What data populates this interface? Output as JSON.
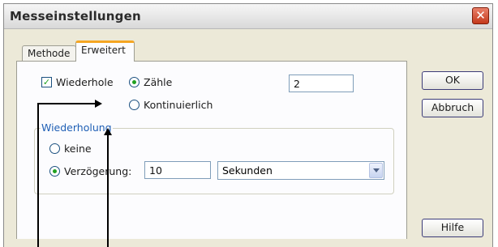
{
  "window": {
    "title": "Messeinstellungen"
  },
  "tabs": [
    {
      "label": "Methode"
    },
    {
      "label": "Erweitert"
    }
  ],
  "repeat": {
    "label": "Wiederhole",
    "checked": true
  },
  "mode": {
    "count_label": "Zähle",
    "continuous_label": "Kontinuierlich",
    "count_value": "2"
  },
  "group": {
    "title": "Wiederholung",
    "none_label": "keine",
    "delay_label": "Verzögerung:",
    "delay_value": "10",
    "unit_value": "Sekunden"
  },
  "buttons": {
    "ok": "OK",
    "cancel": "Abbruch",
    "help": "Hilfe"
  },
  "colors": {
    "accent_tab": "#f5a623",
    "check_green": "#21a121",
    "group_title": "#1f5fb5",
    "close_red": "#c4391b"
  }
}
